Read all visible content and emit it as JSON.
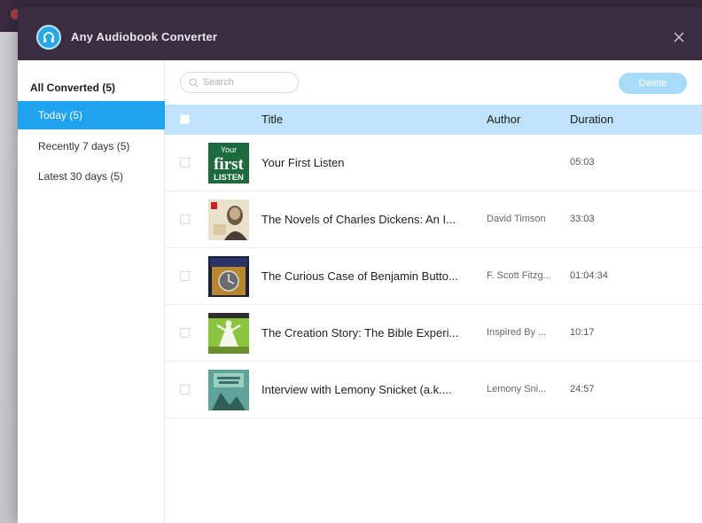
{
  "window": {
    "title": "Any Audiobook Converter",
    "logo_icon": "headphones-icon",
    "close_icon": "close-icon"
  },
  "sidebar": {
    "header": "All Converted (5)",
    "items": [
      {
        "label": "Today (5)",
        "active": true
      },
      {
        "label": "Recently 7 days (5)",
        "active": false
      },
      {
        "label": "Latest 30 days (5)",
        "active": false
      }
    ]
  },
  "toolbar": {
    "search_placeholder": "Search",
    "search_value": "",
    "delete_label": "Delete"
  },
  "table": {
    "columns": [
      "Title",
      "Author",
      "Duration"
    ],
    "rows": [
      {
        "cover_text": [
          "Your",
          "first",
          "LISTEN"
        ],
        "title": "Your First Listen",
        "author": "",
        "duration": "05:03"
      },
      {
        "title": "The Novels of Charles Dickens: An I...",
        "author": "David Timson",
        "duration": "33:03"
      },
      {
        "title": "The Curious Case of Benjamin Butto...",
        "author": "F. Scott Fitzg...",
        "duration": "01:04:34"
      },
      {
        "title": "The Creation Story: The Bible Experi...",
        "author": "Inspired By ...",
        "duration": "10:17"
      },
      {
        "title": "Interview with Lemony Snicket (a.k....",
        "author": "Lemony Sni...",
        "duration": "24:57"
      }
    ]
  },
  "colors": {
    "titlebar": "#3b2d41",
    "accent": "#1fa3ef",
    "table_header": "#bfe3fb",
    "delete_disabled": "#a8dbf8"
  }
}
